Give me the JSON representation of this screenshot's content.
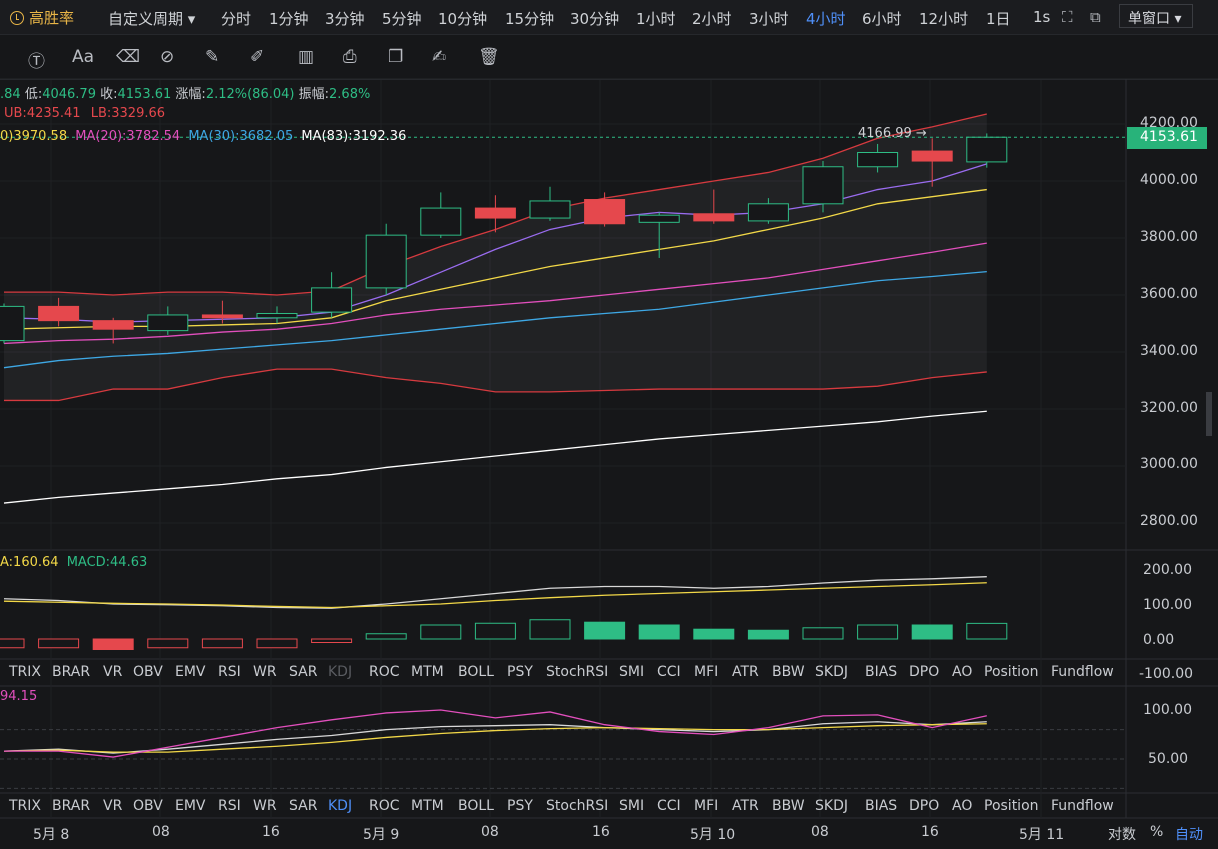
{
  "brand": {
    "name": "高胜率",
    "icon": "coin-icon"
  },
  "periods": [
    {
      "label": "自定义周期 ▾",
      "x": 108
    },
    {
      "label": "分时",
      "x": 221
    },
    {
      "label": "1分钟",
      "x": 269
    },
    {
      "label": "3分钟",
      "x": 325
    },
    {
      "label": "5分钟",
      "x": 382
    },
    {
      "label": "10分钟",
      "x": 438
    },
    {
      "label": "15分钟",
      "x": 505
    },
    {
      "label": "30分钟",
      "x": 570
    },
    {
      "label": "1小时",
      "x": 636
    },
    {
      "label": "2小时",
      "x": 692
    },
    {
      "label": "3小时",
      "x": 749
    },
    {
      "label": "4小时",
      "x": 806,
      "active": true
    },
    {
      "label": "6小时",
      "x": 862
    },
    {
      "label": "12小时",
      "x": 919
    },
    {
      "label": "1日",
      "x": 986
    },
    {
      "label": "1s",
      "x": 1033
    }
  ],
  "window_mode": "单窗口 ▾",
  "ohlc": {
    "prefix": ".84",
    "low_label": "低:",
    "low": "4046.79",
    "close_label": "收:",
    "close": "4153.61",
    "chg_label": "涨幅:",
    "chg": "2.12%(86.04)",
    "amp_label": "振幅:",
    "amp": "2.68%"
  },
  "boll": {
    "ub": "UB:4235.41",
    "lb": "LB:3329.66"
  },
  "ma": {
    "ma10": "0)3970.58",
    "ma20": "MA(20):3782.54",
    "ma30": "MA(30):3682.05",
    "ma83": "MA(83):3192.36"
  },
  "high_marker": "4166.99 →",
  "last_price": "4153.61",
  "price_axis": [
    "4200.00",
    "4000.00",
    "3800.00",
    "3600.00",
    "3400.00",
    "3200.00",
    "3000.00",
    "2800.00"
  ],
  "macd": {
    "dea": "A:160.64",
    "macd": "MACD:44.63",
    "axis": [
      "200.00",
      "100.00",
      "0.00",
      "-100.00"
    ]
  },
  "kdj": {
    "value": "94.15",
    "axis": [
      "100.00",
      "50.00"
    ]
  },
  "indicator_tabs": [
    "TRIX",
    "BRAR",
    "VR",
    "OBV",
    "EMV",
    "RSI",
    "WR",
    "SAR",
    "KDJ",
    "ROC",
    "MTM",
    "BOLL",
    "PSY",
    "StochRSI",
    "SMI",
    "CCI",
    "MFI",
    "ATR",
    "BBW",
    "SKDJ",
    "BIAS",
    "DPO",
    "AO",
    "Position",
    "Fundflow"
  ],
  "time_axis": [
    "5月 8",
    "08",
    "16",
    "5月 9",
    "08",
    "16",
    "5月 10",
    "08",
    "16",
    "5月 11"
  ],
  "footer": {
    "log": "对数",
    "pct": "%",
    "auto": "自动"
  },
  "colors": {
    "up": "#2ebd85",
    "down": "#e5484d",
    "accent": "#4f8ff7",
    "brand": "#e8b547"
  },
  "chart_data": {
    "type": "candlestick",
    "ylim": [
      2700,
      4300
    ],
    "candles": [
      {
        "o": 3440,
        "c": 3560,
        "h": 3570,
        "l": 3430
      },
      {
        "o": 3560,
        "c": 3510,
        "h": 3590,
        "l": 3490
      },
      {
        "o": 3510,
        "c": 3480,
        "h": 3520,
        "l": 3430
      },
      {
        "o": 3475,
        "c": 3530,
        "h": 3560,
        "l": 3460
      },
      {
        "o": 3530,
        "c": 3520,
        "h": 3580,
        "l": 3500
      },
      {
        "o": 3520,
        "c": 3535,
        "h": 3560,
        "l": 3500
      },
      {
        "o": 3540,
        "c": 3625,
        "h": 3680,
        "l": 3520
      },
      {
        "o": 3625,
        "c": 3810,
        "h": 3850,
        "l": 3600
      },
      {
        "o": 3810,
        "c": 3905,
        "h": 3960,
        "l": 3800
      },
      {
        "o": 3905,
        "c": 3870,
        "h": 3950,
        "l": 3820
      },
      {
        "o": 3870,
        "c": 3930,
        "h": 3980,
        "l": 3860
      },
      {
        "o": 3935,
        "c": 3850,
        "h": 3960,
        "l": 3840
      },
      {
        "o": 3855,
        "c": 3880,
        "h": 3890,
        "l": 3730
      },
      {
        "o": 3885,
        "c": 3860,
        "h": 3970,
        "l": 3850
      },
      {
        "o": 3860,
        "c": 3920,
        "h": 3940,
        "l": 3850
      },
      {
        "o": 3920,
        "c": 4050,
        "h": 4070,
        "l": 3890
      },
      {
        "o": 4050,
        "c": 4100,
        "h": 4130,
        "l": 4030
      },
      {
        "o": 4105,
        "c": 4070,
        "h": 4150,
        "l": 3980
      },
      {
        "o": 4067,
        "c": 4153.61,
        "h": 4166.99,
        "l": 4046.79
      }
    ],
    "boll_ub": [
      3610,
      3610,
      3600,
      3610,
      3610,
      3600,
      3615,
      3700,
      3770,
      3830,
      3900,
      3940,
      3970,
      4000,
      4030,
      4080,
      4150,
      4190,
      4235
    ],
    "boll_lb": [
      3230,
      3230,
      3270,
      3270,
      3310,
      3340,
      3340,
      3310,
      3290,
      3260,
      3260,
      3265,
      3270,
      3270,
      3270,
      3270,
      3280,
      3310,
      3330
    ],
    "ma_short": [
      3520,
      3515,
      3505,
      3510,
      3515,
      3520,
      3540,
      3600,
      3680,
      3760,
      3830,
      3870,
      3890,
      3880,
      3890,
      3920,
      3970,
      4000,
      4060
    ],
    "ma10": [
      3480,
      3485,
      3490,
      3490,
      3495,
      3500,
      3520,
      3580,
      3620,
      3660,
      3700,
      3730,
      3760,
      3790,
      3830,
      3870,
      3920,
      3945,
      3970
    ],
    "ma20": [
      3430,
      3440,
      3445,
      3455,
      3470,
      3480,
      3500,
      3530,
      3550,
      3565,
      3580,
      3600,
      3620,
      3640,
      3660,
      3690,
      3720,
      3750,
      3782
    ],
    "ma30": [
      3345,
      3370,
      3385,
      3395,
      3410,
      3425,
      3440,
      3460,
      3480,
      3500,
      3520,
      3535,
      3550,
      3575,
      3600,
      3625,
      3650,
      3665,
      3682
    ],
    "ma83": [
      2870,
      2890,
      2905,
      2920,
      2935,
      2955,
      2970,
      2995,
      3015,
      3035,
      3055,
      3075,
      3095,
      3110,
      3125,
      3140,
      3155,
      3175,
      3192
    ],
    "macd_hist": [
      -25,
      -25,
      -30,
      -25,
      -25,
      -25,
      -10,
      15,
      40,
      45,
      55,
      48,
      40,
      28,
      25,
      32,
      40,
      40,
      44.63
    ],
    "macd_dif": [
      115,
      110,
      100,
      98,
      95,
      90,
      88,
      100,
      115,
      130,
      145,
      150,
      150,
      145,
      150,
      160,
      168,
      172,
      178
    ],
    "macd_dea": [
      108,
      105,
      102,
      100,
      97,
      93,
      90,
      95,
      100,
      110,
      118,
      125,
      130,
      135,
      140,
      145,
      150,
      155,
      160.64
    ],
    "kdj_j": [
      58,
      58,
      52,
      62,
      72,
      82,
      90,
      97,
      100,
      92,
      98,
      85,
      78,
      75,
      82,
      94,
      95,
      82,
      94.15
    ],
    "kdj_k": [
      58,
      60,
      56,
      60,
      65,
      70,
      74,
      80,
      83,
      84,
      85,
      82,
      80,
      78,
      80,
      86,
      88,
      85,
      88
    ],
    "kdj_d": [
      58,
      59,
      57,
      57,
      60,
      63,
      67,
      72,
      76,
      79,
      81,
      82,
      81,
      80,
      80,
      82,
      84,
      85,
      86
    ]
  }
}
